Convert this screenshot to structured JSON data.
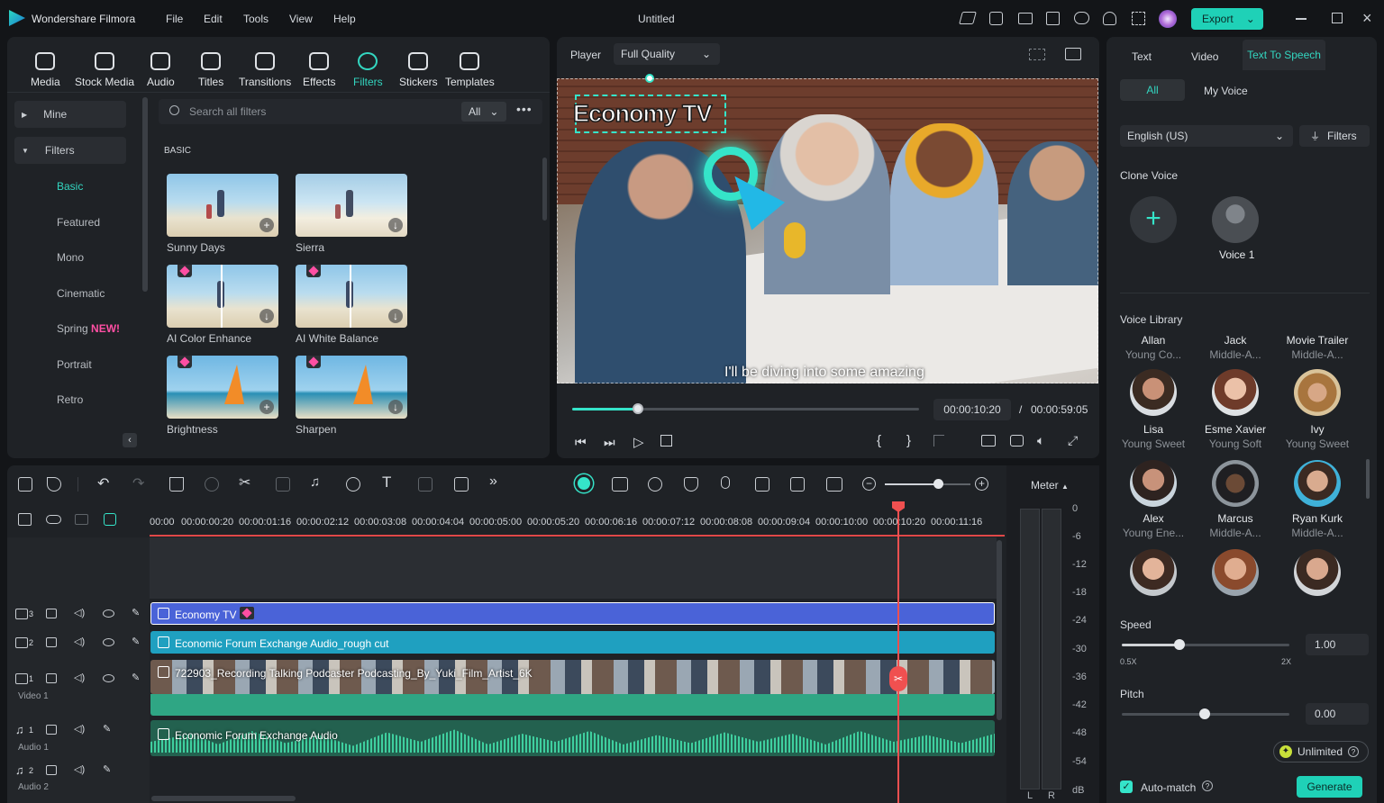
{
  "app": {
    "name": "Wondershare Filmora",
    "doc_title": "Untitled",
    "menu": [
      "File",
      "Edit",
      "Tools",
      "View",
      "Help"
    ],
    "export_label": "Export",
    "accent": "#1fd1b7",
    "pink": "#ff4fa3"
  },
  "toolbar": {
    "items": [
      "Media",
      "Stock Media",
      "Audio",
      "Titles",
      "Transitions",
      "Effects",
      "Filters",
      "Stickers",
      "Templates"
    ],
    "active": "Filters"
  },
  "sidebar": {
    "mine": "Mine",
    "filters": "Filters",
    "subs": [
      "Basic",
      "Featured",
      "Mono",
      "Cinematic",
      "Spring",
      "Portrait",
      "Retro"
    ],
    "new_badge": "NEW!",
    "active": "Basic"
  },
  "search": {
    "placeholder": "Search all filters",
    "scope": "All"
  },
  "section": {
    "title": "BASIC"
  },
  "filters_grid": [
    {
      "label": "Sunny Days",
      "premium": false
    },
    {
      "label": "Sierra",
      "premium": false
    },
    {
      "label": "AI Color Enhance",
      "premium": true
    },
    {
      "label": "AI White Balance",
      "premium": true
    },
    {
      "label": "Brightness",
      "premium": true
    },
    {
      "label": "Sharpen",
      "premium": true
    }
  ],
  "player": {
    "label": "Player",
    "quality": "Full Quality",
    "title_overlay": "Economy TV",
    "subtitle": "I'll be diving into some amazing",
    "current_time": "00:00:10:20",
    "total_time": "00:00:59:05",
    "progress": 0.12
  },
  "timeline": {
    "ruler": [
      "00:00",
      "00:00:00:20",
      "00:00:01:16",
      "00:00:02:12",
      "00:00:03:08",
      "00:00:04:04",
      "00:00:05:00",
      "00:00:05:20",
      "00:00:06:16",
      "00:00:07:12",
      "00:00:08:08",
      "00:00:09:04",
      "00:00:10:00",
      "00:00:10:20",
      "00:00:11:16"
    ],
    "tracks": [
      {
        "num": "3",
        "clip": "Economy TV",
        "color": "#4a63d8"
      },
      {
        "num": "2",
        "clip": "Economic Forum Exchange Audio_rough cut",
        "color": "#1fa0c0"
      },
      {
        "num": "1",
        "name": "Video 1",
        "clip": "722903_Recording Talking Podcaster Podcasting_By_Yuki_Film_Artist_6K"
      },
      {
        "num": "1",
        "name": "Audio 1",
        "clip": "Economic Forum Exchange Audio"
      },
      {
        "num": "2",
        "name": "Audio 2"
      }
    ]
  },
  "meter": {
    "label": "Meter",
    "levels": [
      "0",
      "-6",
      "-12",
      "-18",
      "-24",
      "-30",
      "-36",
      "-42",
      "-48",
      "-54",
      "dB"
    ],
    "channels": [
      "L",
      "R"
    ]
  },
  "tts": {
    "tabs": [
      "Text",
      "Video",
      "Text To Speech"
    ],
    "active_tab": "Text To Speech",
    "subtabs": [
      "All",
      "My Voice"
    ],
    "language": "English (US)",
    "filters": "Filters",
    "clone_title": "Clone Voice",
    "clone_voice": "Voice 1",
    "library_title": "Voice Library",
    "voices": [
      {
        "name": "Allan",
        "desc": "Young Co..."
      },
      {
        "name": "Jack",
        "desc": "Middle-A..."
      },
      {
        "name": "Movie Trailer",
        "desc": "Middle-A..."
      },
      {
        "name": "Lisa",
        "desc": "Young Sweet"
      },
      {
        "name": "Esme Xavier",
        "desc": "Young Soft"
      },
      {
        "name": "Ivy",
        "desc": "Young Sweet"
      },
      {
        "name": "Alex",
        "desc": "Young Ene..."
      },
      {
        "name": "Marcus",
        "desc": "Middle-A..."
      },
      {
        "name": "Ryan Kurk",
        "desc": "Middle-A..."
      }
    ],
    "speed_label": "Speed",
    "speed_value": "1.00",
    "speed_min": "0.5X",
    "speed_max": "2X",
    "pitch_label": "Pitch",
    "pitch_value": "0.00",
    "unlimited": "Unlimited",
    "auto_match": "Auto-match",
    "generate": "Generate"
  }
}
